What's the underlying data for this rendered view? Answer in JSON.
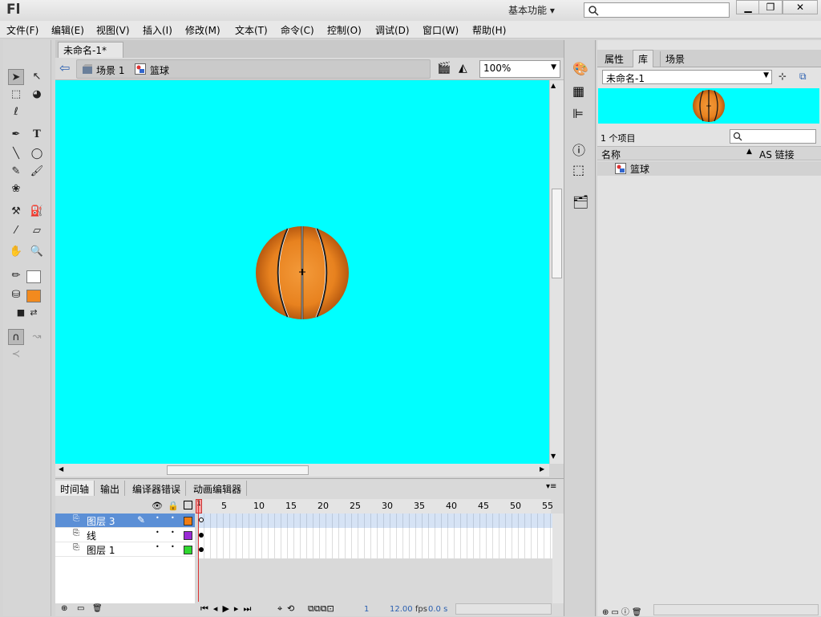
{
  "app": {
    "logo": "Fl",
    "workspace": "基本功能",
    "workspace_arrow": "▾",
    "min": "▁",
    "restore": "❐",
    "close": "✕"
  },
  "menu": [
    "文件(F)",
    "编辑(E)",
    "视图(V)",
    "插入(I)",
    "修改(M)",
    "文本(T)",
    "命令(C)",
    "控制(O)",
    "调试(D)",
    "窗口(W)",
    "帮助(H)"
  ],
  "document": {
    "tab": "未命名-1*",
    "tab_close": "×",
    "scene": "场景 1",
    "symbol": "篮球",
    "zoom": "100%"
  },
  "colors": {
    "stage": "#00ffff",
    "ball": "#e8821f",
    "fill_swatch": "#f28a1e"
  },
  "timeline": {
    "tabs": [
      "时间轴",
      "输出",
      "编译器错误",
      "动画编辑器"
    ],
    "ruler": [
      "5",
      "10",
      "15",
      "20",
      "25",
      "30",
      "35",
      "40",
      "45",
      "50",
      "55"
    ],
    "playhead": "1",
    "layers": [
      {
        "name": "图层 3",
        "color": "#f27d13"
      },
      {
        "name": "线",
        "color": "#9b2bd6"
      },
      {
        "name": "图层 1",
        "color": "#2fd82f"
      }
    ],
    "status": {
      "frame": "1",
      "fps": "12.00",
      "fps_unit": "fps",
      "time": "0.0 s"
    }
  },
  "library": {
    "tabs": [
      "属性",
      "库",
      "场景"
    ],
    "document": "未命名-1",
    "count": "1 个项目",
    "col_name": "名称",
    "col_link": "AS 链接",
    "items": [
      {
        "name": "篮球"
      }
    ]
  }
}
